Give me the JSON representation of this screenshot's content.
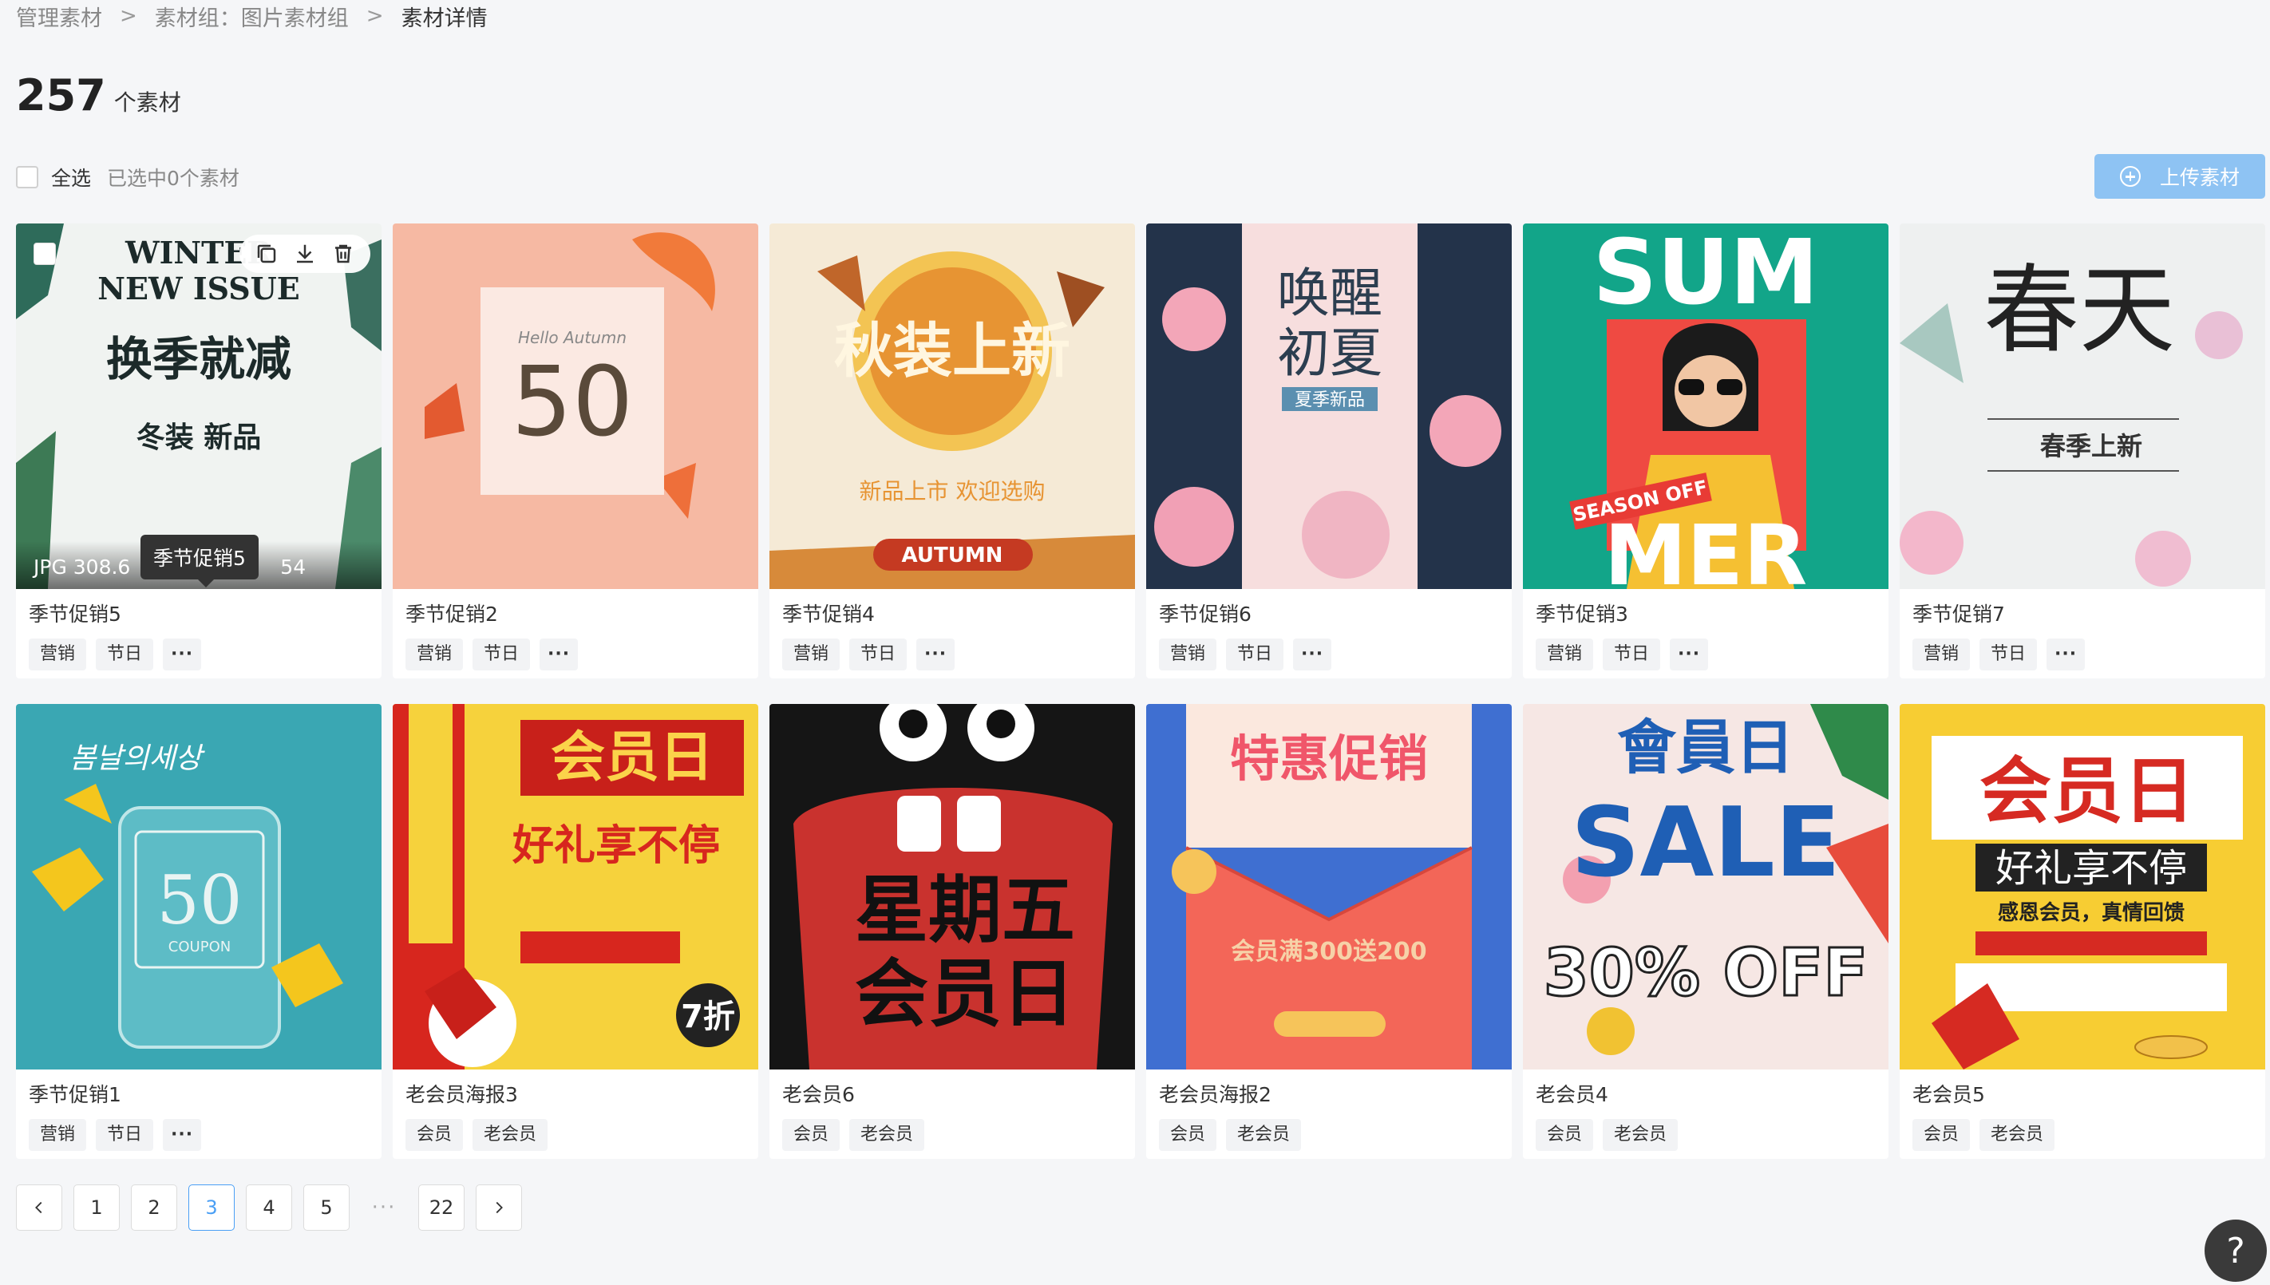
{
  "breadcrumb": [
    {
      "label": "管理素材"
    },
    {
      "label": "素材组：图片素材组"
    },
    {
      "label": "素材详情"
    }
  ],
  "summary": {
    "count": "257",
    "unit": "个素材"
  },
  "selection": {
    "all_label": "全选",
    "selected_text": "已选中0个素材"
  },
  "upload": {
    "label": "上传素材"
  },
  "hover": {
    "file_info": "JPG 308.6",
    "file_info_tail": "54",
    "tooltip": "季节促销5"
  },
  "items": [
    {
      "name": "季节促销5",
      "tags": [
        "营销",
        "节日"
      ],
      "more": "···",
      "art": {
        "headline": "WINTER",
        "sub": "NEW ISSUE",
        "big": "换季就减",
        "line2": "冬装 新品",
        "bg": "#f0f3f1",
        "accent": "#1c2a2a"
      }
    },
    {
      "name": "季节促销2",
      "tags": [
        "营销",
        "节日"
      ],
      "more": "···",
      "art": {
        "headline": "50",
        "sub": "Hello Autumn",
        "bg": "#f6b9a3",
        "accent": "#5a4a3a"
      }
    },
    {
      "name": "季节促销4",
      "tags": [
        "营销",
        "节日"
      ],
      "more": "···",
      "art": {
        "headline": "秋装上新",
        "sub": "AUTUMN",
        "line2": "新品上市 欢迎选购",
        "bg": "#f5ead6",
        "accent": "#e79433"
      }
    },
    {
      "name": "季节促销6",
      "tags": [
        "营销",
        "节日"
      ],
      "more": "···",
      "art": {
        "headline": "唤醒",
        "sub": "初夏",
        "line2": "夏季新品",
        "bg": "#f7dede",
        "accent": "#2c3e50"
      }
    },
    {
      "name": "季节促销3",
      "tags": [
        "营销",
        "节日"
      ],
      "more": "···",
      "art": {
        "headline": "SUM",
        "sub": "MER",
        "line2": "SEASON OFF",
        "bg": "#12a589",
        "accent": "#ffffff"
      }
    },
    {
      "name": "季节促销7",
      "tags": [
        "营销",
        "节日"
      ],
      "more": "···",
      "art": {
        "headline": "春天",
        "sub": "春季上新",
        "bg": "#eef0f0",
        "accent": "#222222"
      }
    },
    {
      "name": "季节促销1",
      "tags": [
        "营销",
        "节日"
      ],
      "more": "···",
      "art": {
        "headline": "50",
        "sub": "COUPON",
        "bg": "#3aa7b3",
        "accent": "#e9f4f3"
      }
    },
    {
      "name": "老会员海报3",
      "tags": [
        "会员",
        "老会员"
      ],
      "more": "",
      "art": {
        "headline": "会员日",
        "sub": "好礼享不停",
        "line2": "7折",
        "bg": "#f6d23c",
        "accent": "#d7261e"
      }
    },
    {
      "name": "老会员6",
      "tags": [
        "会员",
        "老会员"
      ],
      "more": "",
      "art": {
        "headline": "星期五",
        "sub": "会员日",
        "bg": "#151515",
        "accent": "#c9322e"
      }
    },
    {
      "name": "老会员海报2",
      "tags": [
        "会员",
        "老会员"
      ],
      "more": "",
      "art": {
        "headline": "特惠促销",
        "sub": "会员满300送200",
        "bg": "#f36658",
        "accent": "#f6d2a8"
      }
    },
    {
      "name": "老会员4",
      "tags": [
        "会员",
        "老会员"
      ],
      "more": "",
      "art": {
        "headline": "會員日",
        "sub": "SALE",
        "line2": "30% OFF",
        "bg": "#f6e7e4",
        "accent": "#1f5fb5"
      }
    },
    {
      "name": "老会员5",
      "tags": [
        "会员",
        "老会员"
      ],
      "more": "",
      "art": {
        "headline": "会员日",
        "sub": "好礼享不停",
        "line2": "感恩会员，真情回馈",
        "bg": "#f7cd33",
        "accent": "#d62a22"
      }
    }
  ],
  "pagination": {
    "pages": [
      "1",
      "2",
      "3",
      "4",
      "5",
      "···",
      "22"
    ],
    "active": "3"
  },
  "help": {
    "label": "?"
  },
  "colors": {
    "accent": "#4a9ff5",
    "upload_bg": "#8ec3f3",
    "page_bg": "#f5f6f8"
  }
}
